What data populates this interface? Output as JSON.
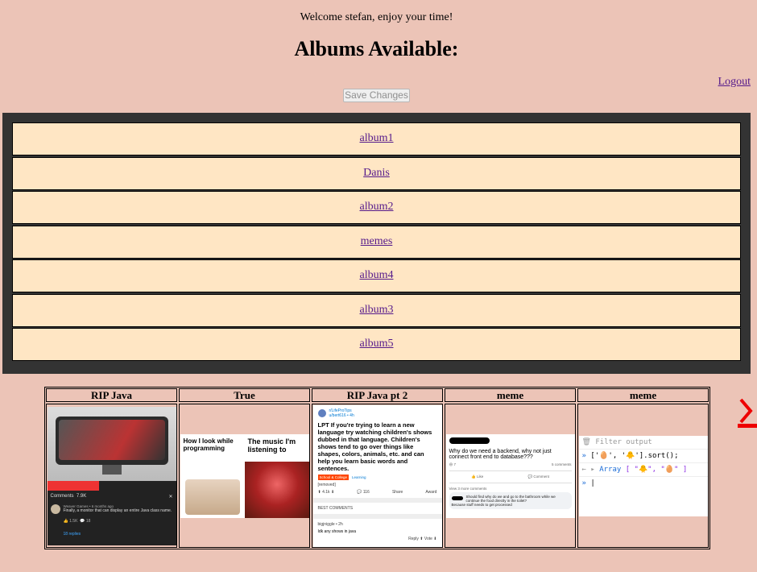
{
  "header": {
    "welcome": "Welcome stefan, enjoy your time!",
    "title": "Albums Available:",
    "logout": "Logout",
    "save_button": "Save Changes"
  },
  "albums": [
    "album1",
    "Danis",
    "album2",
    "memes",
    "album4",
    "album3",
    "album5"
  ],
  "memes": [
    {
      "title": "RIP Java",
      "comments_label": "Comments",
      "comments_count": "7.9K",
      "comment_author": "Weaver Games • 6 months ago",
      "comment_text": "Finally, a monitor that can display an entire Java class name.",
      "likes": "1.5K",
      "replies_count": "18",
      "replies_link": "18 replies"
    },
    {
      "title": "True",
      "left_caption": "How I look while programming",
      "right_caption": "The music I'm listening to"
    },
    {
      "title": "RIP Java pt 2",
      "subreddit": "r/LifeProTips",
      "user": "u/bert616 • 4h",
      "post": "LPT If you're trying to learn a new language try watching children's shows dubbed in that language. Children's shows tend to go over things like shapes, colors, animals, etc. and can help you learn basic words and sentences.",
      "tag_school": "School & College",
      "tag_learning": "Learning",
      "removed": "[removed]",
      "votes": "4.1k",
      "comments": "116",
      "share": "Share",
      "award": "Award",
      "best_comments": "BEST COMMENTS",
      "reply_user": "bigjniggle • 2h",
      "reply_text": "Idk any shows in java",
      "reply": "Reply",
      "vote": "Vote"
    },
    {
      "title": "meme",
      "question": "Why do we need a backend, why not just connect front end to database???",
      "reactions": "7",
      "comments_count": "5 comments",
      "like": "Like",
      "comment": "Comment",
      "view_more": "View 3 more comments",
      "reply_text": "Should find why do we and go to the bathroom while we continue the food directly in the toilet?",
      "reply_text2": "Because stuff needs to get processed"
    },
    {
      "title": "meme",
      "filter_placeholder": "Filter output",
      "input_prefix": "»",
      "input_code_open": "['",
      "input_code_middle": "', '",
      "input_code_close": "'].sort();",
      "output_prefix": "←",
      "output_label": "Array",
      "output_value": "[ \"🐥\", \"🥚\" ]",
      "input_item1": "🥚",
      "input_item2": "🐥"
    }
  ],
  "colors": {
    "background": "#ecc4b7",
    "panel": "#333333",
    "album_row": "#ffe6c4",
    "link": "#551a8b",
    "next_arrow": "#ee0000"
  },
  "icons": {
    "next": "chevron-right-icon"
  }
}
